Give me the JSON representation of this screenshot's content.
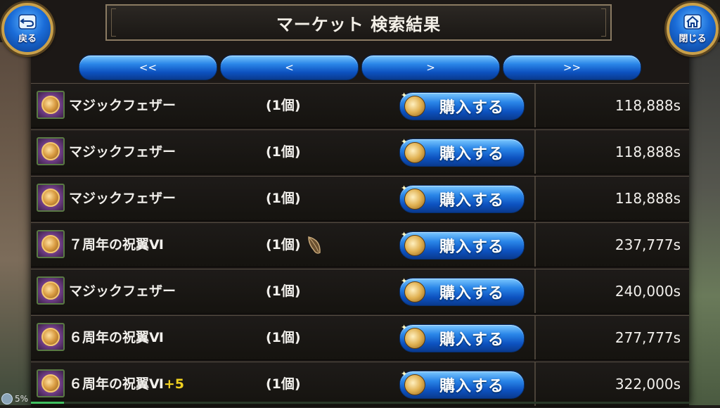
{
  "header": {
    "title": "マーケット 検索結果",
    "back_label": "戻る",
    "close_label": "閉じる"
  },
  "pager": {
    "first": "<<",
    "prev": "<",
    "next": ">",
    "last": ">>"
  },
  "buy_label": "購入する",
  "rows": [
    {
      "name": "マジックフェザー",
      "plus": "",
      "qty": "(1個)",
      "price": "118,888s",
      "leaf": false
    },
    {
      "name": "マジックフェザー",
      "plus": "",
      "qty": "(1個)",
      "price": "118,888s",
      "leaf": false
    },
    {
      "name": "マジックフェザー",
      "plus": "",
      "qty": "(1個)",
      "price": "118,888s",
      "leaf": false
    },
    {
      "name": "７周年の祝翼Ⅵ",
      "plus": "",
      "qty": "(1個)",
      "price": "237,777s",
      "leaf": true
    },
    {
      "name": "マジックフェザー",
      "plus": "",
      "qty": "(1個)",
      "price": "240,000s",
      "leaf": false
    },
    {
      "name": "６周年の祝翼Ⅵ",
      "plus": "",
      "qty": "(1個)",
      "price": "277,777s",
      "leaf": false
    },
    {
      "name": "６周年の祝翼Ⅵ",
      "plus": "+5",
      "qty": "(1個)",
      "price": "322,000s",
      "leaf": false
    }
  ],
  "status": {
    "battery_text": "5%",
    "progress_fraction": 0.05
  },
  "colors": {
    "button_blue": "#1a6cd8",
    "frame_gold": "#c9a04a",
    "plus_yellow": "#f0d020"
  }
}
